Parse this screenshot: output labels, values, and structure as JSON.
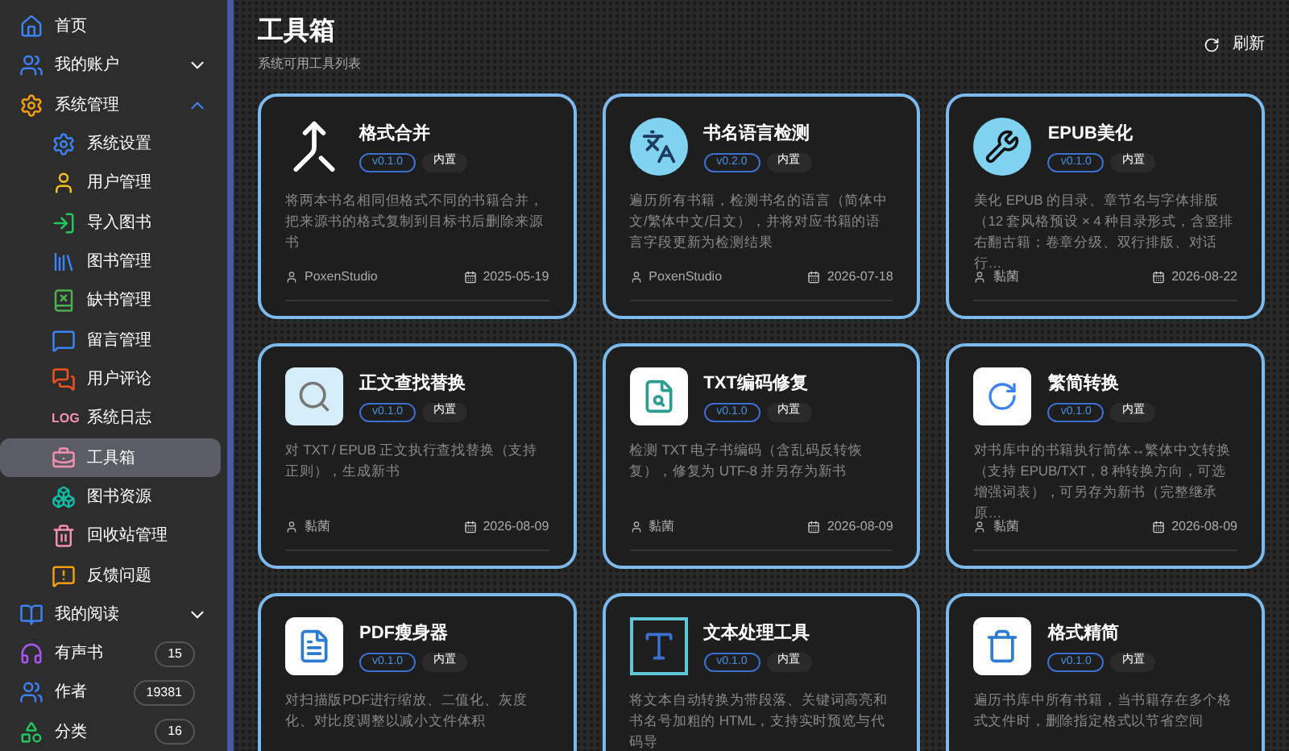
{
  "sidebar": {
    "items": [
      {
        "label": "首页",
        "selected": false
      },
      {
        "label": "我的账户",
        "selected": false,
        "expanded": false
      },
      {
        "label": "系统管理",
        "selected": false,
        "expanded": true,
        "children": [
          {
            "label": "系统设置",
            "selected": false
          },
          {
            "label": "用户管理",
            "selected": false
          },
          {
            "label": "导入图书",
            "selected": false
          },
          {
            "label": "图书管理",
            "selected": false
          },
          {
            "label": "缺书管理",
            "selected": false
          },
          {
            "label": "留言管理",
            "selected": false
          },
          {
            "label": "用户评论",
            "selected": false
          },
          {
            "label": "系统日志",
            "selected": false,
            "icon_text": "LOG"
          },
          {
            "label": "工具箱",
            "selected": true
          },
          {
            "label": "图书资源",
            "selected": false
          },
          {
            "label": "回收站管理",
            "selected": false
          },
          {
            "label": "反馈问题",
            "selected": false
          }
        ]
      },
      {
        "label": "我的阅读",
        "selected": false,
        "expanded": false
      },
      {
        "label": "有声书",
        "selected": false,
        "badge": "15"
      },
      {
        "label": "作者",
        "selected": false,
        "badge": "19381"
      },
      {
        "label": "分类",
        "selected": false,
        "badge": "16"
      }
    ]
  },
  "header": {
    "title": "工具箱",
    "subtitle": "系统可用工具列表",
    "refresh_button": "刷新"
  },
  "tools": [
    {
      "name": "格式合并",
      "version": "v0.1.0",
      "tag": "内置",
      "description": "将两本书名相同但格式不同的书籍合并，把来源书的格式复制到目标书后删除来源书",
      "author": "PoxenStudio",
      "date": "2025-05-19"
    },
    {
      "name": "书名语言检测",
      "version": "v0.2.0",
      "tag": "内置",
      "description": "遍历所有书籍，检测书名的语言（简体中文/繁体中文/日文），并将对应书籍的语言字段更新为检测结果",
      "author": "PoxenStudio",
      "date": "2026-07-18"
    },
    {
      "name": "EPUB美化",
      "version": "v0.1.0",
      "tag": "内置",
      "description": "美化 EPUB 的目录、章节名与字体排版（12 套风格预设 × 4 种目录形式，含竖排右翻古籍；卷章分级、双行排版、对话行…",
      "author": "黏菌",
      "date": "2026-08-22"
    },
    {
      "name": "正文查找替换",
      "version": "v0.1.0",
      "tag": "内置",
      "description": "对 TXT / EPUB 正文执行查找替换（支持正则），生成新书",
      "author": "黏菌",
      "date": "2026-08-09"
    },
    {
      "name": "TXT编码修复",
      "version": "v0.1.0",
      "tag": "内置",
      "description": "检测 TXT 电子书编码（含乱码反转恢复），修复为 UTF-8 并另存为新书",
      "author": "黏菌",
      "date": "2026-08-09"
    },
    {
      "name": "繁简转换",
      "version": "v0.1.0",
      "tag": "内置",
      "description": "对书库中的书籍执行简体↔繁体中文转换（支持 EPUB/TXT，8 种转换方向，可选增强词表），可另存为新书（完整继承原…",
      "author": "黏菌",
      "date": "2026-08-09"
    },
    {
      "name": "PDF瘦身器",
      "version": "v0.1.0",
      "tag": "内置",
      "description": "对扫描版PDF进行缩放、二值化、灰度化、对比度调整以减小文件体积"
    },
    {
      "name": "文本处理工具",
      "version": "v0.1.0",
      "tag": "内置",
      "description": "将文本自动转换为带段落、关键词高亮和书名号加粗的 HTML，支持实时预览与代码导"
    },
    {
      "name": "格式精简",
      "version": "v0.1.0",
      "tag": "内置",
      "description": "遍历书库中所有书籍，当书籍存在多个格式文件时，删除指定格式以节省空间"
    }
  ]
}
